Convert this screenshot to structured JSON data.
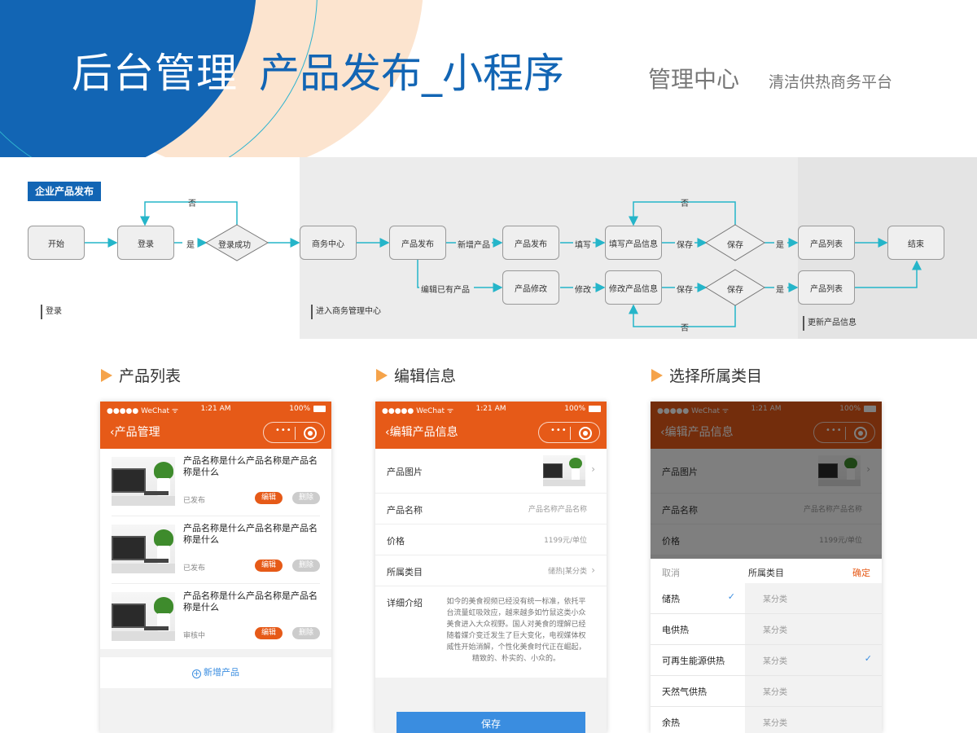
{
  "header": {
    "title_main": "后台管理",
    "title_sub": "产品发布_小程序",
    "center_label": "管理中心",
    "platform_name": "清洁供热商务平台"
  },
  "flow": {
    "tag": "企业产品发布",
    "nodes": {
      "start": "开始",
      "login": "登录",
      "login_success": "登录成功",
      "biz_center": "商务中心",
      "product_publish": "产品发布",
      "product_publish2": "产品发布",
      "fill_info": "填写产品信息",
      "save_top": "保存",
      "list_top": "产品列表",
      "end": "结束",
      "product_modify": "产品修改",
      "modify_info": "修改产品信息",
      "save_bottom": "保存",
      "list_bottom": "产品列表"
    },
    "labels": {
      "no_login": "否",
      "yes_login": "是",
      "new_product": "新增产品",
      "fill": "填写",
      "save1": "保存",
      "yes1": "是",
      "no_top": "否",
      "edit_existing": "编辑已有产品",
      "modify": "修改",
      "save2": "保存",
      "yes2": "是",
      "no_bottom": "否"
    },
    "sections": {
      "login": "登录",
      "enter_center": "进入商务管理中心",
      "update_info": "更新产品信息"
    }
  },
  "section_titles": {
    "list": "产品列表",
    "edit": "编辑信息",
    "category": "选择所属类目"
  },
  "status_bar": {
    "carrier": "●●●●● WeChat ᯤ",
    "time": "1:21 AM",
    "battery": "100%"
  },
  "capsule": {
    "dots": "•••"
  },
  "phone1": {
    "nav_title": "产品管理",
    "items": [
      {
        "name": "产品名称是什么产品名称是产品名称是什么",
        "status": "已发布",
        "edit": "编辑",
        "delete": "删除"
      },
      {
        "name": "产品名称是什么产品名称是产品名称是什么",
        "status": "已发布",
        "edit": "编辑",
        "delete": "删除"
      },
      {
        "name": "产品名称是什么产品名称是产品名称是什么",
        "status": "审核中",
        "edit": "编辑",
        "delete": "删除"
      }
    ],
    "add_label": "新增产品"
  },
  "phone2": {
    "nav_title": "编辑产品信息",
    "image_label": "产品图片",
    "name_label": "产品名称",
    "name_value": "产品名称产品名称",
    "price_label": "价格",
    "price_value": "1199元/单位",
    "category_label": "所属类目",
    "category_value": "储热|某分类",
    "desc_label": "详细介绍",
    "desc_text": "如今的美食视频已经没有统一标准，依托平台流量虹吸效应，越来越多如竹鼠这类小众美食进入大众视野。国人对美食的理解已经随着媒介变迁发生了巨大变化，电视媒体权威性开始消解，个性化美食时代正在崛起，精致的、朴实的、小众的。",
    "save_label": "保存"
  },
  "phone3": {
    "nav_title": "编辑产品信息",
    "image_label": "产品图片",
    "name_label": "产品名称",
    "name_value": "产品名称产品名称",
    "price_label": "价格",
    "price_value": "1199元/单位",
    "picker": {
      "cancel": "取消",
      "title": "所属类目",
      "confirm": "确定",
      "categories": [
        "储热",
        "电供热",
        "可再生能源供热",
        "天然气供热",
        "余热"
      ],
      "subcategories": [
        "某分类",
        "某分类",
        "某分类",
        "某分类",
        "某分类"
      ],
      "checkmark": "✓"
    }
  },
  "colors": {
    "brand_blue": "#1265b4",
    "accent_orange": "#e65a18",
    "flow_line": "#25b5c9",
    "link_blue": "#3a8de0"
  }
}
